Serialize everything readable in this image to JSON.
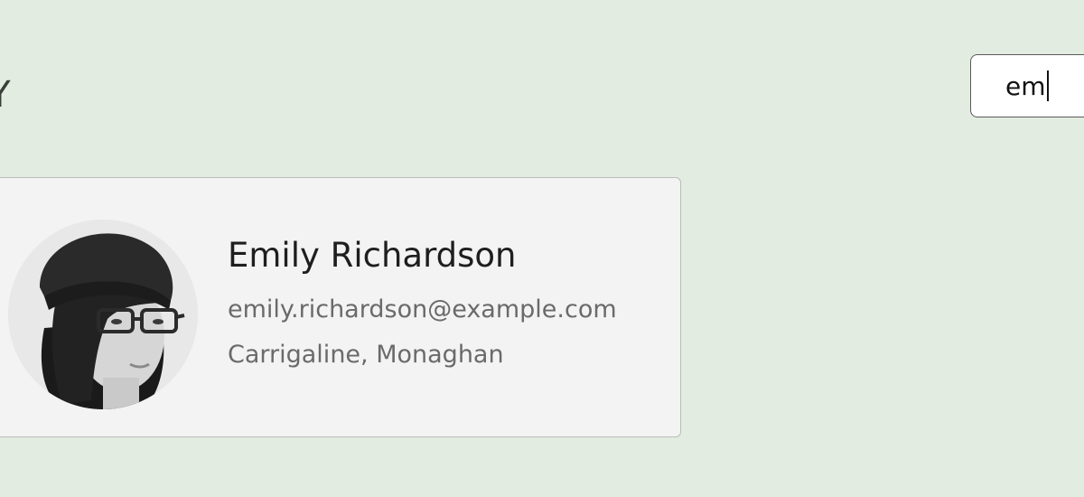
{
  "header": {
    "title_fragment": "RY"
  },
  "search": {
    "value": "em"
  },
  "results": [
    {
      "name": "Emily Richardson",
      "email": "emily.richardson@example.com",
      "location": "Carrigaline, Monaghan",
      "avatar": "user-photo"
    }
  ]
}
